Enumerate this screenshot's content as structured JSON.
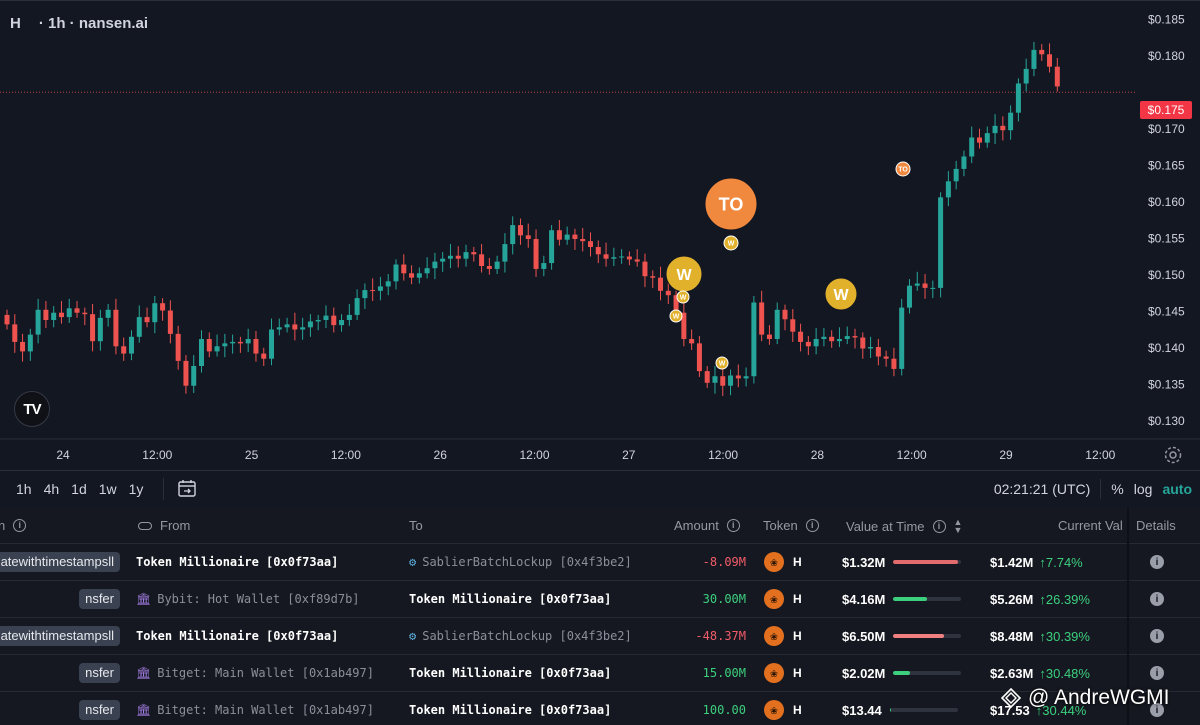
{
  "chart": {
    "symbol": "H",
    "subtitle": "· 1h · nansen.ai",
    "current_price_label": "$0.175",
    "logo_text": "TV",
    "price_axis": [
      "$0.185",
      "$0.180",
      "$0.175",
      "$0.170",
      "$0.165",
      "$0.160",
      "$0.155",
      "$0.150",
      "$0.145",
      "$0.140",
      "$0.135",
      "$0.130"
    ],
    "time_axis": [
      "24",
      "12:00",
      "25",
      "12:00",
      "26",
      "12:00",
      "27",
      "12:00",
      "28",
      "12:00",
      "29",
      "12:00"
    ],
    "colors": {
      "up": "#26a69a",
      "down": "#ef5350",
      "marker_w": "#e1b12c",
      "marker_to": "#f0883e"
    },
    "markers": [
      {
        "label": "TO",
        "kind": "to",
        "size": "large"
      },
      {
        "label": "W",
        "kind": "w",
        "size": "large"
      },
      {
        "label": "W",
        "kind": "w",
        "size": "large"
      },
      {
        "label": "TO",
        "kind": "to",
        "size": "small"
      },
      {
        "label": "W",
        "kind": "w",
        "size": "small"
      },
      {
        "label": "W",
        "kind": "w",
        "size": "small"
      },
      {
        "label": "W",
        "kind": "w",
        "size": "small"
      },
      {
        "label": "W",
        "kind": "w",
        "size": "small"
      }
    ]
  },
  "chart_data": {
    "type": "candlestick",
    "title": "H · 1h · nansen.ai",
    "ylim": [
      0.1275,
      0.1875
    ],
    "yticks": [
      0.185,
      0.18,
      0.175,
      0.17,
      0.165,
      0.16,
      0.155,
      0.15,
      0.145,
      0.14,
      0.135,
      0.13
    ],
    "xticks": [
      "24",
      "12:00",
      "25",
      "12:00",
      "26",
      "12:00",
      "27",
      "12:00",
      "28",
      "12:00",
      "29",
      "12:00"
    ],
    "last_price": 0.175,
    "close": [
      0.1432,
      0.1408,
      0.1395,
      0.1418,
      0.1452,
      0.1438,
      0.1448,
      0.1442,
      0.1454,
      0.1448,
      0.1446,
      0.1409,
      0.1441,
      0.1452,
      0.1402,
      0.1392,
      0.1415,
      0.1442,
      0.1435,
      0.1461,
      0.1451,
      0.1419,
      0.1382,
      0.1348,
      0.1375,
      0.1412,
      0.1395,
      0.1402,
      0.1406,
      0.1408,
      0.1406,
      0.1412,
      0.1392,
      0.1385,
      0.1425,
      0.1428,
      0.1432,
      0.1425,
      0.1428,
      0.1436,
      0.1438,
      0.1444,
      0.1431,
      0.1438,
      0.1445,
      0.1468,
      0.1479,
      0.1478,
      0.1484,
      0.1491,
      0.1514,
      0.1502,
      0.1496,
      0.1502,
      0.1509,
      0.1518,
      0.1522,
      0.1526,
      0.1522,
      0.1531,
      0.1528,
      0.1512,
      0.1508,
      0.1518,
      0.1542,
      0.1568,
      0.1554,
      0.1549,
      0.1508,
      0.1516,
      0.1561,
      0.1548,
      0.1555,
      0.1549,
      0.1546,
      0.1538,
      0.1528,
      0.1522,
      0.1524,
      0.1525,
      0.1521,
      0.1518,
      0.1498,
      0.1496,
      0.1478,
      0.1472,
      0.1448,
      0.1412,
      0.1406,
      0.1368,
      0.1352,
      0.1361,
      0.1348,
      0.1362,
      0.1358,
      0.1361,
      0.1462,
      0.1418,
      0.1412,
      0.1452,
      0.1439,
      0.1422,
      0.1408,
      0.1402,
      0.1412,
      0.1415,
      0.1409,
      0.1412,
      0.1416,
      0.1414,
      0.1399,
      0.1401,
      0.1388,
      0.1385,
      0.1371,
      0.1455,
      0.1485,
      0.1488,
      0.1482,
      0.1482,
      0.1606,
      0.1628,
      0.1645,
      0.1662,
      0.1688,
      0.1681,
      0.1694,
      0.1704,
      0.1698,
      0.1722,
      0.1762,
      0.1782,
      0.1808,
      0.1802,
      0.1785,
      0.1758
    ]
  },
  "toolbar": {
    "timeframes": [
      "1h",
      "4h",
      "1d",
      "1w",
      "1y"
    ],
    "clock": "02:21:21 (UTC)",
    "pct": "%",
    "log": "log",
    "auto": "auto"
  },
  "table": {
    "headers": {
      "type": "n",
      "from": "From",
      "to": "To",
      "amount": "Amount",
      "token": "Token",
      "value_at_time": "Value at Time",
      "current_value": "Current Val",
      "details": "Details"
    },
    "rows": [
      {
        "type": "atewithtimestampsll",
        "from": "Token Millionaire [0x0f73aa]",
        "from_style": "bold",
        "to": "SablierBatchLockup [0x4f3be2]",
        "to_style": "dim",
        "to_icon": "robot-icon",
        "from_icon": "",
        "amount": "-8.09M",
        "amount_sign": "neg",
        "token": "H",
        "value_at_time": "$1.32M",
        "bar_fill": 0.95,
        "bar_color": "#e26b6e",
        "current_value": "$1.42M",
        "change": "↑7.74%"
      },
      {
        "type": "nsfer",
        "from": "Bybit: Hot Wallet [0xf89d7b]",
        "from_style": "dim",
        "from_icon": "bank-icon",
        "to": "Token Millionaire [0x0f73aa]",
        "to_style": "bold",
        "to_icon": "",
        "amount": "30.00M",
        "amount_sign": "pos",
        "token": "H",
        "value_at_time": "$4.16M",
        "bar_fill": 0.5,
        "bar_color": "#3ccf7e",
        "current_value": "$5.26M",
        "change": "↑26.39%"
      },
      {
        "type": "atewithtimestampsll",
        "from": "Token Millionaire [0x0f73aa]",
        "from_style": "bold",
        "from_icon": "",
        "to": "SablierBatchLockup [0x4f3be2]",
        "to_style": "dim",
        "to_icon": "robot-icon",
        "amount": "-48.37M",
        "amount_sign": "neg",
        "token": "H",
        "value_at_time": "$6.50M",
        "bar_fill": 0.75,
        "bar_color": "#f08080",
        "current_value": "$8.48M",
        "change": "↑30.39%"
      },
      {
        "type": "nsfer",
        "from": "Bitget: Main Wallet [0x1ab497]",
        "from_style": "dim",
        "from_icon": "bank-icon",
        "to": "Token Millionaire [0x0f73aa]",
        "to_style": "bold",
        "to_icon": "",
        "amount": "15.00M",
        "amount_sign": "pos",
        "token": "H",
        "value_at_time": "$2.02M",
        "bar_fill": 0.25,
        "bar_color": "#3ccf7e",
        "current_value": "$2.63M",
        "change": "↑30.48%"
      },
      {
        "type": "nsfer",
        "from": "Bitget: Main Wallet [0x1ab497]",
        "from_style": "dim",
        "from_icon": "bank-icon",
        "to": "Token Millionaire [0x0f73aa]",
        "to_style": "bold",
        "to_icon": "",
        "amount": "100.00",
        "amount_sign": "pos",
        "token": "H",
        "value_at_time": "$13.44",
        "bar_fill": 0.02,
        "bar_color": "#3ccf7e",
        "current_value": "$17.53",
        "change": "↑30.44%"
      }
    ]
  },
  "watermark": "@ AndreWGMI"
}
